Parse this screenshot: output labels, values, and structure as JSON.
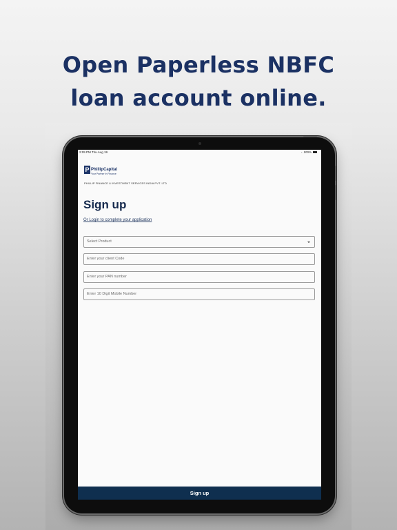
{
  "headline": {
    "line1": "Open Paperless NBFC",
    "line2": "loan account online."
  },
  "status_bar": {
    "time": "2:09 PM  Thu Aug 19",
    "battery": "100%"
  },
  "brand": {
    "logo_letter": "P",
    "name": "PhillipCapital",
    "tagline": "Your Partner In Finance",
    "company": "PHILLIP FINANCE & INVESTMENT SERVICES INDIA PVT. LTD"
  },
  "form": {
    "title": "Sign up",
    "login_link": "Or Login to complete your application",
    "product_select": "Select Product",
    "client_code_placeholder": "Enter your client Code",
    "pan_placeholder": "Enter your PAN number",
    "mobile_placeholder": "Enter 10 Digit Mobile Number",
    "submit_label": "Sign up"
  },
  "colors": {
    "headline": "#1b3163",
    "primary_button": "#0f2f4f",
    "brand": "#1d3468"
  }
}
